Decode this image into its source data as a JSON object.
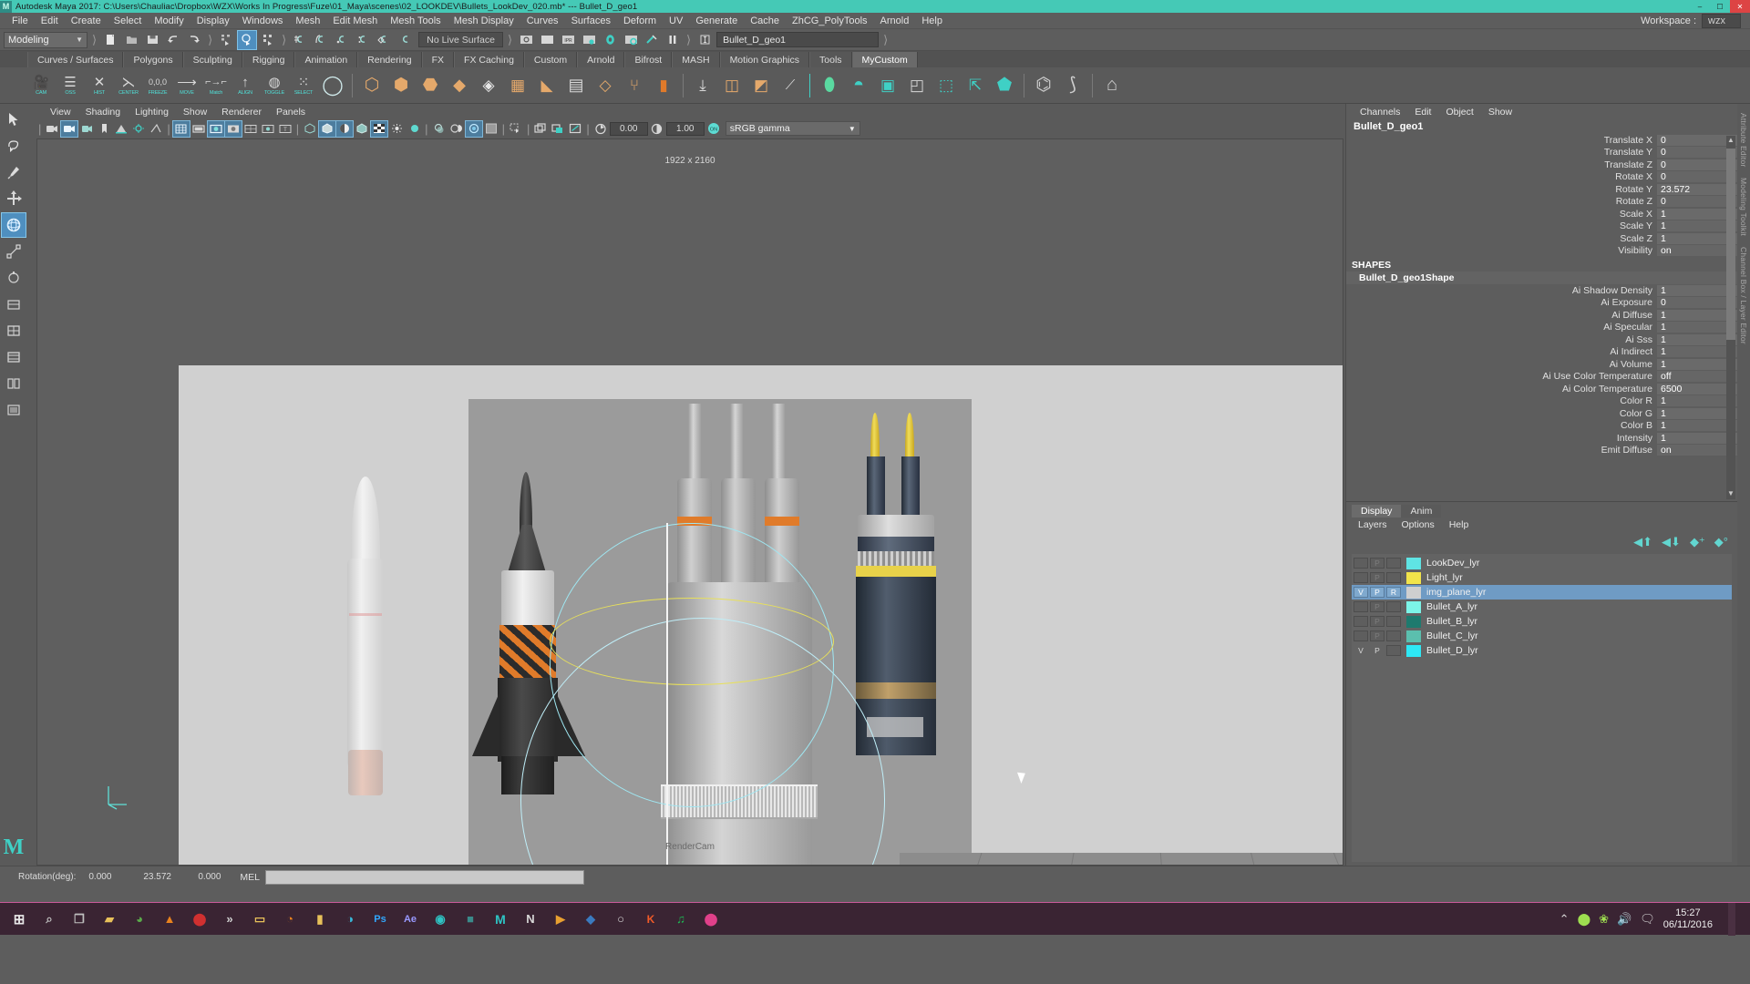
{
  "titlebar": {
    "app_title": "Autodesk Maya 2017: C:\\Users\\Chauliac\\Dropbox\\WZX\\Works In Progress\\Fuze\\01_Maya\\scenes\\02_LOOKDEV\\Bullets_LookDev_020.mb*  ---  Bullet_D_geo1",
    "icon": "maya-logo-icon",
    "minimize": "–",
    "maximize": "☐",
    "close": "✕"
  },
  "menubar": {
    "items": [
      "File",
      "Edit",
      "Create",
      "Select",
      "Modify",
      "Display",
      "Windows",
      "Mesh",
      "Edit Mesh",
      "Mesh Tools",
      "Mesh Display",
      "Curves",
      "Surfaces",
      "Deform",
      "UV",
      "Generate",
      "Cache",
      "ZhCG_PolyTools",
      "Arnold",
      "Help"
    ],
    "workspace_label": "Workspace :",
    "workspace_value": "wzx"
  },
  "statusline": {
    "mode": "Modeling",
    "no_live_surface": "No Live Surface",
    "selection_field": "Bullet_D_geo1",
    "icons": [
      "new-scene-icon",
      "open-scene-icon",
      "save-scene-icon",
      "undo-icon",
      "redo-icon",
      "select-by-hierarchy-icon",
      "select-by-object-icon",
      "select-by-component-icon",
      "snap-to-grid-icon",
      "snap-to-curve-icon",
      "snap-to-point-icon",
      "snap-to-projected-center-icon",
      "snap-to-view-plane-icon",
      "make-live-icon",
      "render-current-frame-icon",
      "render-sequence-icon",
      "ipr-render-icon",
      "render-settings-icon",
      "hypershade-icon",
      "render-view-icon",
      "render-setup-icon",
      "pause-render-icon",
      "input-field-icon"
    ]
  },
  "shelf": {
    "tabs": [
      "Curves / Surfaces",
      "Polygons",
      "Sculpting",
      "Rigging",
      "Animation",
      "Rendering",
      "FX",
      "FX Caching",
      "Custom",
      "Arnold",
      "Bifrost",
      "MASH",
      "Motion Graphics",
      "Tools",
      "MyCustom"
    ],
    "active_tab": "MyCustom",
    "buttons": [
      {
        "cap": "CAM",
        "icon": "camera-icon"
      },
      {
        "cap": "OSS",
        "icon": "optimize-scene-icon"
      },
      {
        "cap": "HIST",
        "icon": "delete-history-icon"
      },
      {
        "cap": "CENTER",
        "icon": "center-pivot-icon"
      },
      {
        "cap": "FREEZE",
        "icon": "freeze-transform-icon"
      },
      {
        "cap": "MOVE",
        "icon": "move-icon"
      },
      {
        "cap": "Match",
        "icon": "match-transform-icon"
      },
      {
        "cap": "ALIGN",
        "icon": "align-icon"
      },
      {
        "cap": "TOGGLE",
        "icon": "toggle-icon"
      },
      {
        "cap": "SELECT",
        "icon": "select-icon"
      },
      {
        "cap": "",
        "icon": "nurbs-sphere-icon"
      },
      {
        "cap": "",
        "icon": "poly-sphere-icon"
      },
      {
        "cap": "",
        "icon": "poly-cube-icon"
      },
      {
        "cap": "",
        "icon": "poly-cylinder-icon"
      },
      {
        "cap": "",
        "icon": "poly-cone-icon"
      },
      {
        "cap": "",
        "icon": "poly-plane-icon"
      },
      {
        "cap": "",
        "icon": "poly-torus-icon"
      },
      {
        "cap": "",
        "icon": "poly-pyramid-icon"
      },
      {
        "cap": "",
        "icon": "poly-prism-icon"
      },
      {
        "cap": "",
        "icon": "combine-icon"
      },
      {
        "cap": "",
        "icon": "separate-icon"
      },
      {
        "cap": "",
        "icon": "booleans-icon"
      },
      {
        "cap": "",
        "icon": "extrude-icon"
      },
      {
        "cap": "",
        "icon": "bevel-icon"
      },
      {
        "cap": "",
        "icon": "bridge-icon"
      },
      {
        "cap": "",
        "icon": "multi-cut-icon"
      },
      {
        "cap": "",
        "icon": "arnold-area-light-icon"
      },
      {
        "cap": "",
        "icon": "arnold-skydome-icon"
      },
      {
        "cap": "",
        "icon": "arnold-render-view-icon"
      },
      {
        "cap": "",
        "icon": "arnold-standin-icon"
      },
      {
        "cap": "",
        "icon": "uv-editor-icon"
      },
      {
        "cap": "",
        "icon": "export-icon"
      },
      {
        "cap": "",
        "icon": "mash-network-icon"
      },
      {
        "cap": "",
        "icon": "mash-trail-icon"
      },
      {
        "cap": "",
        "icon": "ornatrix-icon"
      }
    ]
  },
  "toolbox": {
    "items": [
      {
        "name": "select-tool",
        "icon": "arrow-icon",
        "active": false
      },
      {
        "name": "lasso-tool",
        "icon": "lasso-icon",
        "active": false
      },
      {
        "name": "paint-select-tool",
        "icon": "brush-icon",
        "active": false
      },
      {
        "name": "move-tool",
        "icon": "move-arrows-icon",
        "active": false
      },
      {
        "name": "rotate-tool",
        "icon": "rotate-icon",
        "active": true
      },
      {
        "name": "scale-tool",
        "icon": "scale-icon",
        "active": false
      },
      {
        "name": "last-tool",
        "icon": "wrench-icon",
        "active": false
      },
      {
        "name": "single-pane-layout",
        "icon": "single-pane-icon",
        "active": false
      },
      {
        "name": "two-pane-layout",
        "icon": "two-pane-icon",
        "active": false
      },
      {
        "name": "four-pane-layout",
        "icon": "four-pane-icon",
        "active": false
      },
      {
        "name": "outliner-layout",
        "icon": "outliner-icon",
        "active": false
      }
    ],
    "logo": "M"
  },
  "viewport": {
    "panel_menu": [
      "View",
      "Shading",
      "Lighting",
      "Show",
      "Renderer",
      "Panels"
    ],
    "resolution_gate_label": "1922 x 2160",
    "camera_label": "RenderCam",
    "exposure_value": "0.00",
    "gamma_value": "1.00",
    "color_management": "sRGB gamma",
    "toolbar_icons": [
      "camera-icon",
      "camera-attributes-icon",
      "camera-bookmark-icon",
      "image-plane-icon",
      "two-sided-lighting-icon",
      "shadows-icon",
      "ao-icon",
      "grid-icon",
      "film-gate-icon",
      "resolution-gate-icon",
      "gate-mask-icon",
      "field-chart-icon",
      "safe-action-icon",
      "safe-title-icon",
      "wireframe-icon",
      "smooth-shade-all-icon",
      "flat-shade-icon",
      "wireframe-on-shaded-icon",
      "xray-icon",
      "xray-joints-icon",
      "lights-icon",
      "use-all-lights-icon",
      "shadows-toggle-icon",
      "ao-toggle-icon",
      "motion-blur-icon",
      "isolate-select-icon",
      "select-mask-icon",
      "display-textures-icon",
      "hw-texturing-icon",
      "xray-component-icon",
      "exposure-icon",
      "gamma-icon",
      "color-management-toggle-icon"
    ]
  },
  "channelbox": {
    "menu": [
      "Channels",
      "Edit",
      "Object",
      "Show"
    ],
    "object_name": "Bullet_D_geo1",
    "transform_attrs": [
      {
        "label": "Translate X",
        "value": "0"
      },
      {
        "label": "Translate Y",
        "value": "0"
      },
      {
        "label": "Translate Z",
        "value": "0"
      },
      {
        "label": "Rotate X",
        "value": "0"
      },
      {
        "label": "Rotate Y",
        "value": "23.572"
      },
      {
        "label": "Rotate Z",
        "value": "0"
      },
      {
        "label": "Scale X",
        "value": "1"
      },
      {
        "label": "Scale Y",
        "value": "1"
      },
      {
        "label": "Scale Z",
        "value": "1"
      },
      {
        "label": "Visibility",
        "value": "on"
      }
    ],
    "shapes_header": "SHAPES",
    "shape_name": "Bullet_D_geo1Shape",
    "shape_attrs": [
      {
        "label": "Ai Shadow Density",
        "value": "1"
      },
      {
        "label": "Ai Exposure",
        "value": "0"
      },
      {
        "label": "Ai Diffuse",
        "value": "1"
      },
      {
        "label": "Ai Specular",
        "value": "1"
      },
      {
        "label": "Ai Sss",
        "value": "1"
      },
      {
        "label": "Ai Indirect",
        "value": "1"
      },
      {
        "label": "Ai Volume",
        "value": "1"
      },
      {
        "label": "Ai Use Color Temperature",
        "value": "off"
      },
      {
        "label": "Ai Color Temperature",
        "value": "6500"
      },
      {
        "label": "Color R",
        "value": "1"
      },
      {
        "label": "Color G",
        "value": "1"
      },
      {
        "label": "Color B",
        "value": "1"
      },
      {
        "label": "Intensity",
        "value": "1"
      },
      {
        "label": "Emit Diffuse",
        "value": "on"
      }
    ]
  },
  "layereditor": {
    "tabs": [
      "Display",
      "Anim"
    ],
    "active_tab": "Display",
    "menu": [
      "Layers",
      "Options",
      "Help"
    ],
    "tools": [
      "move-layer-up-icon",
      "move-layer-down-icon",
      "new-layer-icon",
      "new-layer-from-selected-icon"
    ],
    "layers": [
      {
        "v": "",
        "p": "P",
        "r": "",
        "color": "#5fe4e4",
        "name": "LookDev_lyr",
        "selected": false
      },
      {
        "v": "",
        "p": "P",
        "r": "",
        "color": "#f2e44a",
        "name": "Light_lyr",
        "selected": false
      },
      {
        "v": "V",
        "p": "P",
        "r": "R",
        "color": "#cfcfcf",
        "name": "img_plane_lyr",
        "selected": true
      },
      {
        "v": "",
        "p": "P",
        "r": "",
        "color": "#7cf5e8",
        "name": "Bullet_A_lyr",
        "selected": false
      },
      {
        "v": "",
        "p": "P",
        "r": "",
        "color": "#1e7a6e",
        "name": "Bullet_B_lyr",
        "selected": false
      },
      {
        "v": "",
        "p": "P",
        "r": "",
        "color": "#5bbfae",
        "name": "Bullet_C_lyr",
        "selected": false
      },
      {
        "v": "V",
        "p": "P",
        "r": "",
        "color": "#2ee8f5",
        "name": "Bullet_D_lyr",
        "selected": false
      }
    ]
  },
  "righttabs": [
    "Attribute Editor",
    "Modeling Toolkit",
    "Channel Box / Layer Editor"
  ],
  "statusbar": {
    "rotation_label": "Rotation(deg):",
    "rot_x": "0.000",
    "rot_y": "23.572",
    "rot_z": "0.000",
    "mel_label": "MEL",
    "command_value": ""
  },
  "taskbar": {
    "start_icon": "windows-start-icon",
    "apps": [
      {
        "name": "search-icon",
        "glyph": "⚲",
        "color": "#bfbfbf"
      },
      {
        "name": "task-view-icon",
        "glyph": "▣",
        "color": "#bfbfbf"
      },
      {
        "name": "folder-icon",
        "glyph": "▱",
        "color": "#e8c15a"
      },
      {
        "name": "chrome-icon",
        "glyph": "●",
        "color": "#4caf50"
      },
      {
        "name": "vlc-icon",
        "glyph": "▲",
        "color": "#e8821e"
      },
      {
        "name": "recorder-icon",
        "glyph": "●",
        "color": "#d03030"
      },
      {
        "name": "overflow-icon",
        "glyph": "»",
        "color": "#cfcfcf"
      },
      {
        "name": "folder-window-icon",
        "glyph": "▭",
        "color": "#e8c15a"
      },
      {
        "name": "firefox-icon",
        "glyph": "◔",
        "color": "#e8821e"
      },
      {
        "name": "notes-icon",
        "glyph": "▮",
        "color": "#e8c15a"
      },
      {
        "name": "quicktime-icon",
        "glyph": "◑",
        "color": "#38b8d8"
      },
      {
        "name": "photoshop-icon",
        "glyph": "Ps",
        "color": "#31a8ff"
      },
      {
        "name": "aftereffects-icon",
        "glyph": "Ae",
        "color": "#9999ff"
      },
      {
        "name": "substance-icon",
        "glyph": "◉",
        "color": "#2ec4c4"
      },
      {
        "name": "zbrush-icon",
        "glyph": "■",
        "color": "#3a8a8a"
      },
      {
        "name": "maya-icon",
        "glyph": "M",
        "color": "#2ec4c4"
      },
      {
        "name": "nuke-icon",
        "glyph": "N",
        "color": "#d8d8d8"
      },
      {
        "name": "marmoset-icon",
        "glyph": "▶",
        "color": "#e8a030"
      },
      {
        "name": "vray-icon",
        "glyph": "◆",
        "color": "#3a7abf"
      },
      {
        "name": "marvelous-icon",
        "glyph": "○",
        "color": "#d8d8d8"
      },
      {
        "name": "keyshot-icon",
        "glyph": "K",
        "color": "#f05a28"
      },
      {
        "name": "spotify-icon",
        "glyph": "♫",
        "color": "#1db954"
      },
      {
        "name": "musicapp-icon",
        "glyph": "●",
        "color": "#e0408a"
      }
    ],
    "tray": [
      {
        "name": "show-hidden-icons-icon",
        "glyph": "⌃"
      },
      {
        "name": "antivirus-icon",
        "glyph": "●"
      },
      {
        "name": "network-icon",
        "glyph": "☸"
      },
      {
        "name": "volume-icon",
        "glyph": "ὐA"
      },
      {
        "name": "notifications-icon",
        "glyph": "☰"
      }
    ],
    "time": "15:27",
    "date": "06/11/2016"
  },
  "colors": {
    "title_bg": "#45c9b6",
    "ui_bg": "#5d5d5d",
    "accent_teal": "#4fe0d8",
    "selection_blue": "#6f9bc4",
    "taskbar": "#3a2433"
  }
}
